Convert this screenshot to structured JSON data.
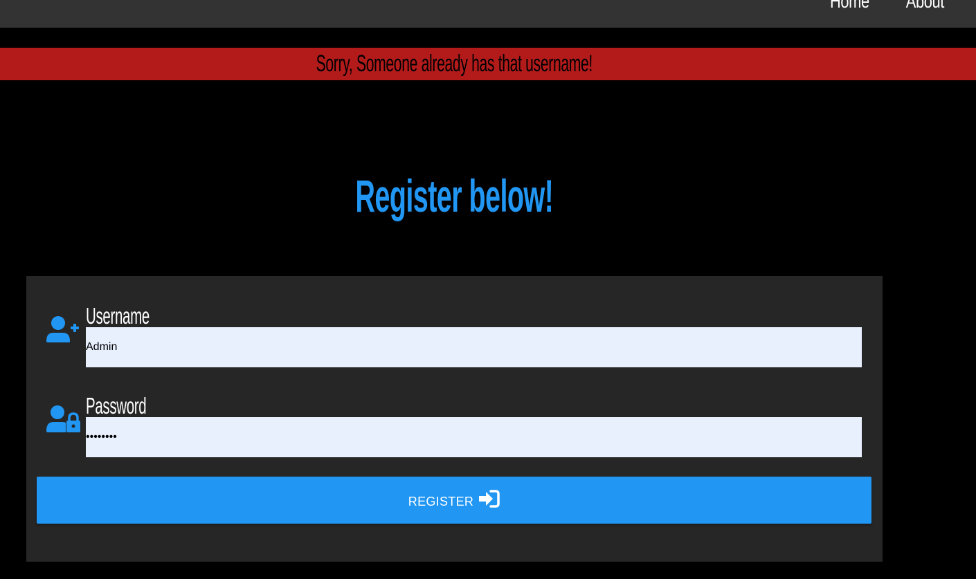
{
  "nav": {
    "links": [
      "Home",
      "About"
    ]
  },
  "flash": {
    "message": "Sorry, Someone already has that username!"
  },
  "page": {
    "title": "Register below!"
  },
  "form": {
    "username_label": "Username",
    "username_value": "Admin",
    "password_label": "Password",
    "password_value": "••••••••",
    "submit_label": "REGISTER"
  },
  "icons": {
    "username": "user-plus-icon",
    "password": "user-lock-icon",
    "submit": "sign-in-icon"
  },
  "colors": {
    "accent": "#2196f3",
    "flash_bg": "#b31b1b",
    "navbar_bg": "#333333",
    "card_bg": "#262626",
    "input_bg": "#e8f0fe"
  }
}
